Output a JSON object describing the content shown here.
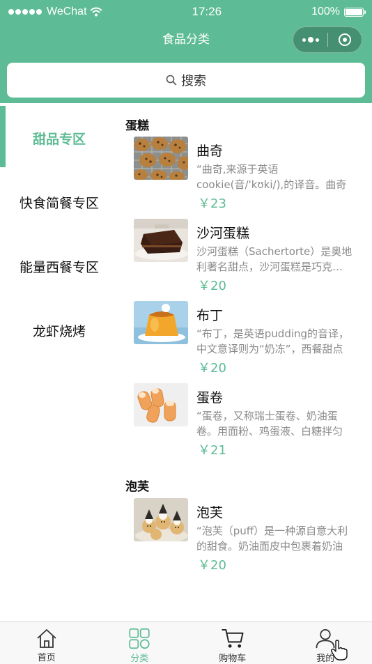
{
  "status_bar": {
    "carrier": "WeChat",
    "time": "17:26",
    "battery_text": "100%",
    "battery_level": 1.0
  },
  "nav": {
    "title": "食品分类",
    "more_icon": "more-dots-icon",
    "close_icon": "target-circle-icon"
  },
  "search": {
    "icon": "search-icon",
    "label": "搜索"
  },
  "sidebar": {
    "items": [
      {
        "label": "甜品专区",
        "active": true
      },
      {
        "label": "快食简餐专区",
        "active": false
      },
      {
        "label": "能量西餐专区",
        "active": false
      },
      {
        "label": "龙虾烧烤",
        "active": false
      }
    ]
  },
  "sections": [
    {
      "title": "蛋糕",
      "items": [
        {
          "name": "曲奇",
          "desc": "“曲奇,来源于英语cookie(音/'kʊki/),的译音。曲奇",
          "price": "￥23",
          "image": "cookies"
        },
        {
          "name": "沙河蛋糕",
          "desc": "沙河蛋糕（Sachertorte）是奥地利著名甜点，沙河蛋糕是巧克力蛋糕",
          "price": "￥20",
          "image": "sachertorte"
        },
        {
          "name": "布丁",
          "desc": "“布丁，是英语pudding的音译，中文意译则为“奶冻”，西餐甜点",
          "price": "￥20",
          "image": "pudding"
        },
        {
          "name": "蛋卷",
          "desc": "“蛋卷，又称瑞士蛋卷、奶油蛋卷。用面粉、鸡蛋液、白糖拌匀",
          "price": "￥21",
          "image": "egg-roll"
        }
      ]
    },
    {
      "title": "泡芙",
      "items": [
        {
          "name": "泡芙",
          "desc": "“泡芙（puff）是一种源自意大利的甜食。奶油面皮中包裹着奶油",
          "price": "￥20",
          "image": "puff"
        }
      ]
    }
  ],
  "tabbar": {
    "items": [
      {
        "label": "首页",
        "icon": "home-icon",
        "active": false
      },
      {
        "label": "分类",
        "icon": "category-grid-icon",
        "active": true
      },
      {
        "label": "购物车",
        "icon": "cart-icon",
        "active": false
      },
      {
        "label": "我的",
        "icon": "user-icon",
        "active": false
      }
    ]
  },
  "colors": {
    "brand": "#5dbb95",
    "price": "#5dbb95",
    "desc": "#8a8a8a"
  }
}
